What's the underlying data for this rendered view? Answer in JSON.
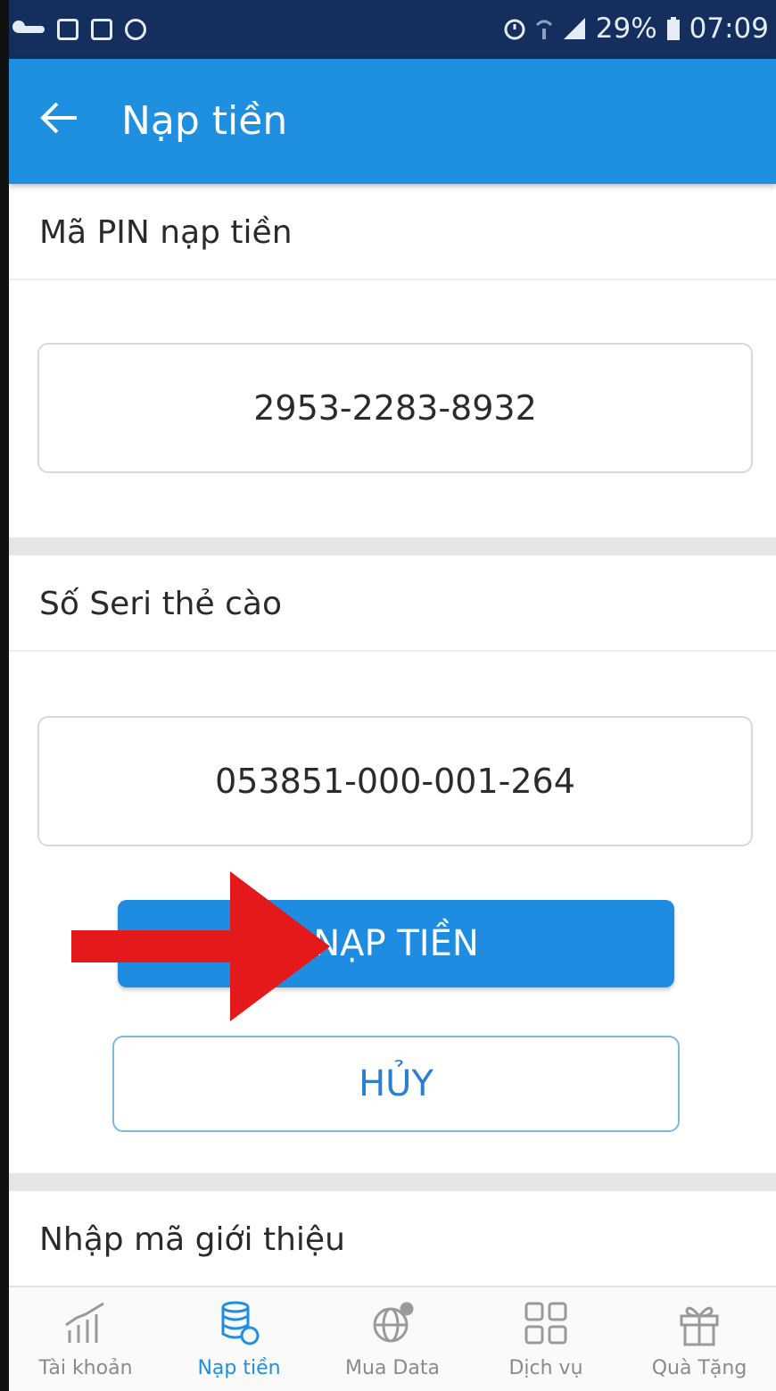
{
  "status_bar": {
    "battery": "29%",
    "time": "07:09"
  },
  "app_bar": {
    "title": "Nạp tiền"
  },
  "pin_section": {
    "label": "Mã PIN nạp tiền",
    "value": "2953-2283-8932"
  },
  "serial_section": {
    "label": "Số Seri thẻ cào",
    "value": "053851-000-001-264"
  },
  "actions": {
    "submit_label": "NẠP TIỀN",
    "cancel_label": "HỦY"
  },
  "referral_section": {
    "label": "Nhập mã giới thiệu"
  },
  "bottom_nav": {
    "items": [
      {
        "label": "Tài khoản",
        "icon": "chart-bars-icon",
        "active": false
      },
      {
        "label": "Nạp tiền",
        "icon": "coin-stack-icon",
        "active": true
      },
      {
        "label": "Mua Data",
        "icon": "globe-icon",
        "active": false
      },
      {
        "label": "Dịch vụ",
        "icon": "grid-apps-icon",
        "active": false
      },
      {
        "label": "Quà Tặng",
        "icon": "gift-icon",
        "active": false
      }
    ]
  },
  "colors": {
    "status_bar": "#142f5e",
    "app_bar": "#1f8fe0",
    "primary_button": "#1e8ce0",
    "active_nav": "#1f8fe0",
    "annotation_arrow": "#e3191b"
  }
}
